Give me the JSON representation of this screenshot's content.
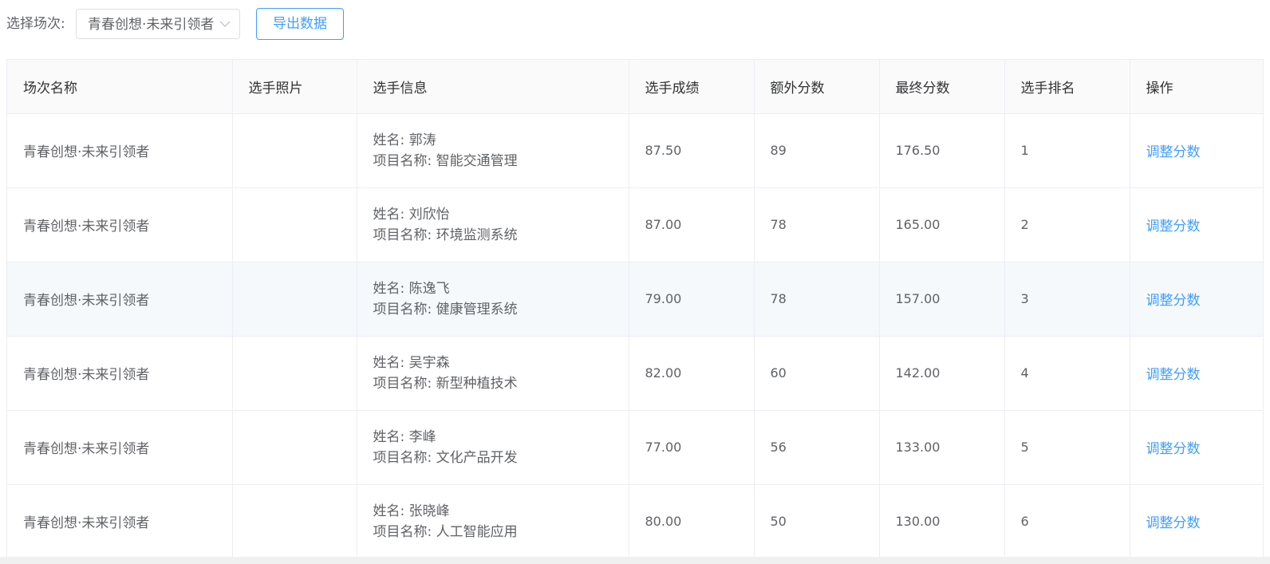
{
  "toolbar": {
    "label": "选择场次:",
    "select_value": "青春创想·未来引领者",
    "export_label": "导出数据"
  },
  "table": {
    "headers": [
      "场次名称",
      "选手照片",
      "选手信息",
      "选手成绩",
      "额外分数",
      "最终分数",
      "选手排名",
      "操作"
    ],
    "rows": [
      {
        "session": "青春创想·未来引领者",
        "name": "姓名: 郭涛",
        "project": "项目名称: 智能交通管理",
        "score": "87.50",
        "extra": "89",
        "final": "176.50",
        "rank": "1",
        "action": "调整分数"
      },
      {
        "session": "青春创想·未来引领者",
        "name": "姓名: 刘欣怡",
        "project": "项目名称: 环境监测系统",
        "score": "87.00",
        "extra": "78",
        "final": "165.00",
        "rank": "2",
        "action": "调整分数"
      },
      {
        "session": "青春创想·未来引领者",
        "name": "姓名: 陈逸飞",
        "project": "项目名称: 健康管理系统",
        "score": "79.00",
        "extra": "78",
        "final": "157.00",
        "rank": "3",
        "action": "调整分数"
      },
      {
        "session": "青春创想·未来引领者",
        "name": "姓名: 吴宇森",
        "project": "项目名称: 新型种植技术",
        "score": "82.00",
        "extra": "60",
        "final": "142.00",
        "rank": "4",
        "action": "调整分数"
      },
      {
        "session": "青春创想·未来引领者",
        "name": "姓名: 李峰",
        "project": "项目名称: 文化产品开发",
        "score": "77.00",
        "extra": "56",
        "final": "133.00",
        "rank": "5",
        "action": "调整分数"
      },
      {
        "session": "青春创想·未来引领者",
        "name": "姓名: 张晓峰",
        "project": "项目名称: 人工智能应用",
        "score": "80.00",
        "extra": "50",
        "final": "130.00",
        "rank": "6",
        "action": "调整分数"
      }
    ]
  },
  "colors": {
    "accent": "#409eff",
    "header_bg": "#fafafa",
    "hover_row_bg": "#f5f9fc",
    "border": "#ebeef5"
  },
  "icons": {
    "select_arrow": "chevron-down-icon"
  }
}
